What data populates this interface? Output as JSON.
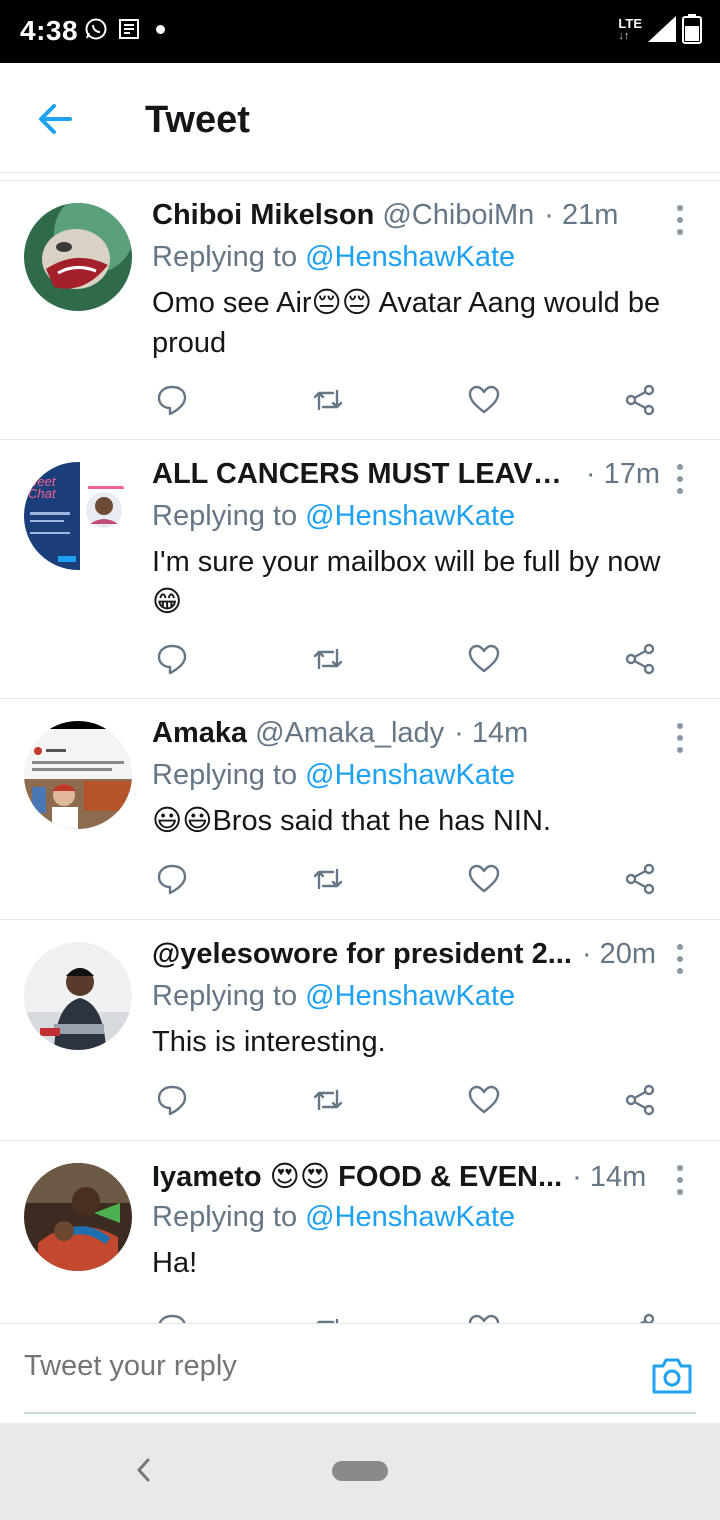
{
  "status_bar": {
    "time": "4:38",
    "network": "LTE",
    "icons": [
      "whatsapp-icon",
      "news-icon",
      "notification-dot",
      "signal-icon",
      "battery-icon"
    ]
  },
  "header": {
    "title": "Tweet",
    "back_icon": "arrow-left-icon",
    "accent_color": "#1da1f2"
  },
  "tweets": [
    {
      "name": "Chiboi Mikelson",
      "handle": "@ChiboiMn",
      "time": "· 21m",
      "replying_prefix": "Replying to ",
      "replying_to": "@HenshawKate",
      "text": "Omo see Air😔😔 Avatar Aang would be proud"
    },
    {
      "name": "ALL CANCERS MUST LEAVE ...",
      "handle": "",
      "time": "· 17m",
      "replying_prefix": "Replying to ",
      "replying_to": "@HenshawKate",
      "text": "I'm sure your mailbox will be full by now 😁"
    },
    {
      "name": "Amaka",
      "handle": "@Amaka_lady",
      "time": "· 14m",
      "replying_prefix": "Replying to ",
      "replying_to": "@HenshawKate",
      "text": "😃😃Bros said that he has NIN."
    },
    {
      "name": "@yelesowore for president 2...",
      "handle": "",
      "time": "· 20m",
      "replying_prefix": "Replying to ",
      "replying_to": "@HenshawKate",
      "text": "This is interesting."
    },
    {
      "name": "Iyameto 😍😍 FOOD & EVEN...",
      "handle": "",
      "time": "· 14m",
      "replying_prefix": "Replying to ",
      "replying_to": "@HenshawKate",
      "text": "Ha!"
    }
  ],
  "composer": {
    "placeholder": "Tweet your reply",
    "camera_icon": "camera-icon"
  },
  "nav_bar": {
    "back_icon": "chevron-left-icon",
    "home_icon": "home-pill-icon"
  }
}
